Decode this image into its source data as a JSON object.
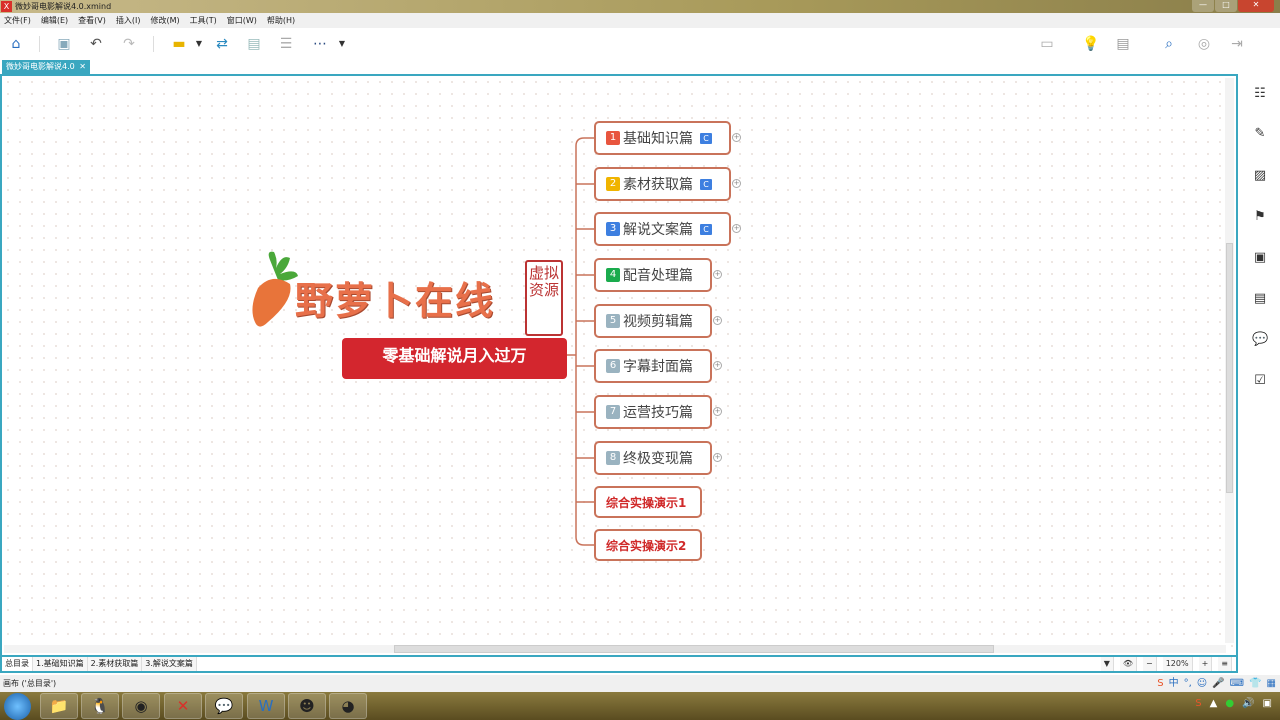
{
  "window": {
    "title": "微妙哥电影解说4.0.xmind",
    "app_icon": "X",
    "buttons": [
      "—",
      "□",
      "✕"
    ]
  },
  "menu": [
    "文件(F)",
    "编辑(E)",
    "查看(V)",
    "插入(I)",
    "修改(M)",
    "工具(T)",
    "窗口(W)",
    "帮助(H)"
  ],
  "tab": {
    "label": "微妙哥电影解说4.0",
    "close": "✕"
  },
  "map": {
    "brand": "野萝卜在线",
    "seal": "虚拟资源",
    "central": "零基础解说月入过万",
    "topics": [
      {
        "num": "1",
        "label": "基础知识篇",
        "color": "#e8553e",
        "has_note": true
      },
      {
        "num": "2",
        "label": "素材获取篇",
        "color": "#f0b400",
        "has_note": true
      },
      {
        "num": "3",
        "label": "解说文案篇",
        "color": "#3d7fe0",
        "has_note": true
      },
      {
        "num": "4",
        "label": "配音处理篇",
        "color": "#1aab4d",
        "has_note": false
      },
      {
        "num": "5",
        "label": "视频剪辑篇",
        "color": "#9ab3c0",
        "has_note": false
      },
      {
        "num": "6",
        "label": "字幕封面篇",
        "color": "#9ab3c0",
        "has_note": false
      },
      {
        "num": "7",
        "label": "运营技巧篇",
        "color": "#9ab3c0",
        "has_note": false
      },
      {
        "num": "8",
        "label": "终极变现篇",
        "color": "#9ab3c0",
        "has_note": false
      }
    ],
    "demos": [
      "综合实操演示1",
      "综合实操演示2"
    ],
    "note_icon": "C",
    "expand": "+"
  },
  "sheets": [
    "总目录",
    "1.基础知识篇",
    "2.素材获取篇",
    "3.解说文案篇"
  ],
  "zoom": {
    "level": "120%",
    "minus": "−",
    "plus": "+",
    "fit": "≡"
  },
  "status": "画布 ('总目录')",
  "ime": {
    "lang": "中",
    "punct": "°,"
  }
}
